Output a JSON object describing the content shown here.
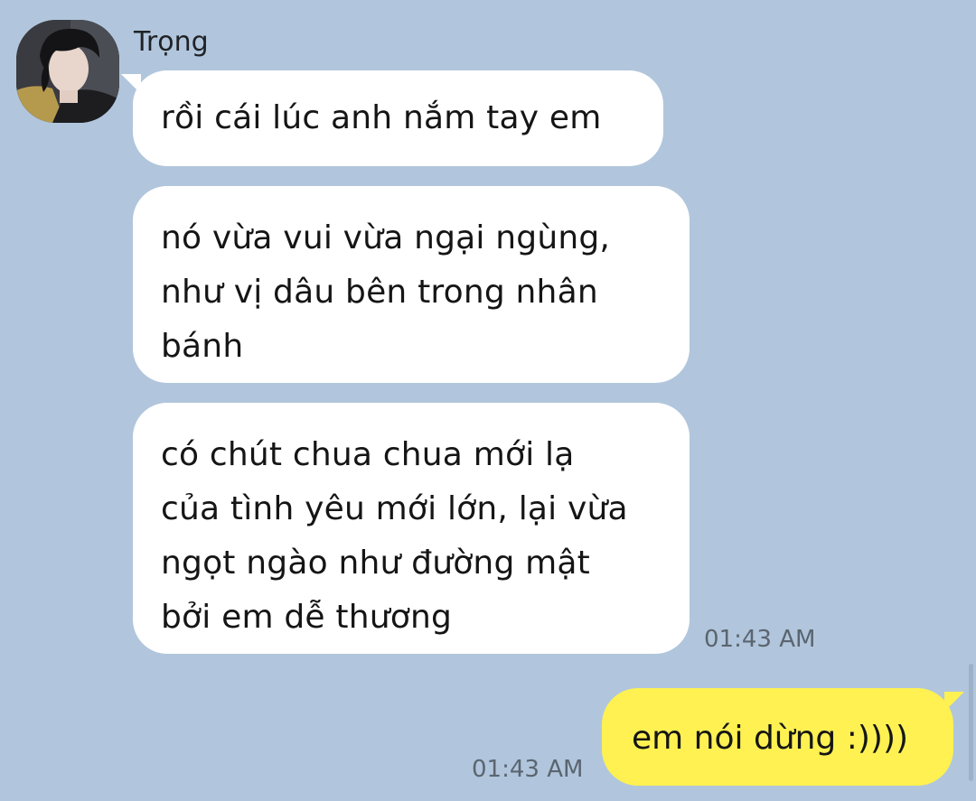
{
  "conversation": {
    "sender": {
      "name": "Trọng",
      "avatar_icon": "profile-photo"
    },
    "incoming_messages": [
      {
        "lines": [
          "rồi cái lúc anh nắm tay em"
        ]
      },
      {
        "lines": [
          "nó vừa vui vừa ngại ngùng,",
          "như vị dâu bên trong nhân",
          "bánh"
        ]
      },
      {
        "lines": [
          "có chút chua chua mới lạ",
          "của tình yêu mới lớn, lại vừa",
          "ngọt ngào như đường mật",
          "bởi em dễ thương"
        ]
      }
    ],
    "incoming_time": "01:43 AM",
    "outgoing_message": {
      "text": "em nói dừng :))))",
      "time": "01:43 AM"
    }
  },
  "colors": {
    "background": "#b1c6dc",
    "incoming_bubble": "#ffffff",
    "outgoing_bubble": "#fef151",
    "timestamp": "#5b6570"
  }
}
